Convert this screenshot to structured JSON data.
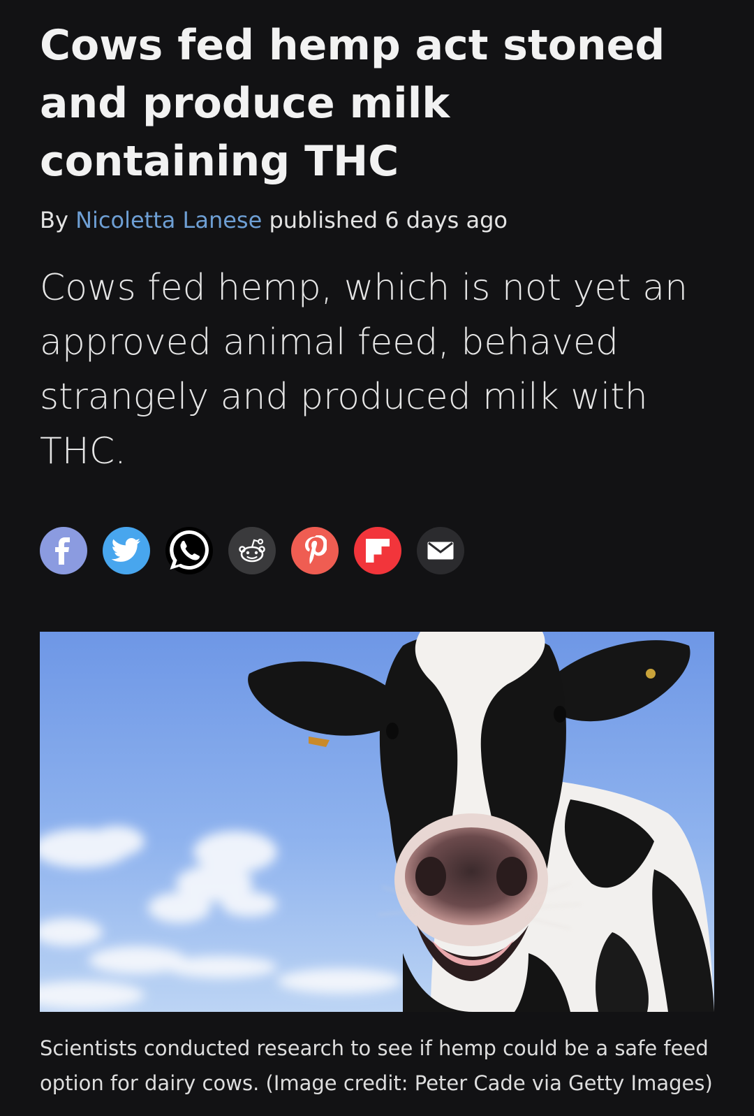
{
  "article": {
    "headline": "Cows fed hemp act stoned and produce milk containing THC",
    "byline": {
      "prefix": "By ",
      "author": "Nicoletta Lanese",
      "published": " published 6 days ago"
    },
    "standfirst": "Cows fed hemp, which is not yet an approved animal feed, behaved strangely and produced milk with THC.",
    "caption": "Scientists conducted research to see if hemp could be a safe feed option for dairy cows. (Image credit: Peter Cade via Getty Images)"
  },
  "share": [
    {
      "name": "facebook",
      "icon": "facebook-icon",
      "color": "#8b9be0"
    },
    {
      "name": "twitter",
      "icon": "twitter-icon",
      "color": "#48a6ee"
    },
    {
      "name": "whatsapp",
      "icon": "whatsapp-icon",
      "color": "#000000"
    },
    {
      "name": "reddit",
      "icon": "reddit-icon",
      "color": "#3a3a3c"
    },
    {
      "name": "pinterest",
      "icon": "pinterest-icon",
      "color": "#ef5d52"
    },
    {
      "name": "flipboard",
      "icon": "flipboard-icon",
      "color": "#f2353b"
    },
    {
      "name": "email",
      "icon": "email-icon",
      "color": "#2b2b2e"
    }
  ],
  "hero_image": {
    "subject": "cow-photo"
  }
}
